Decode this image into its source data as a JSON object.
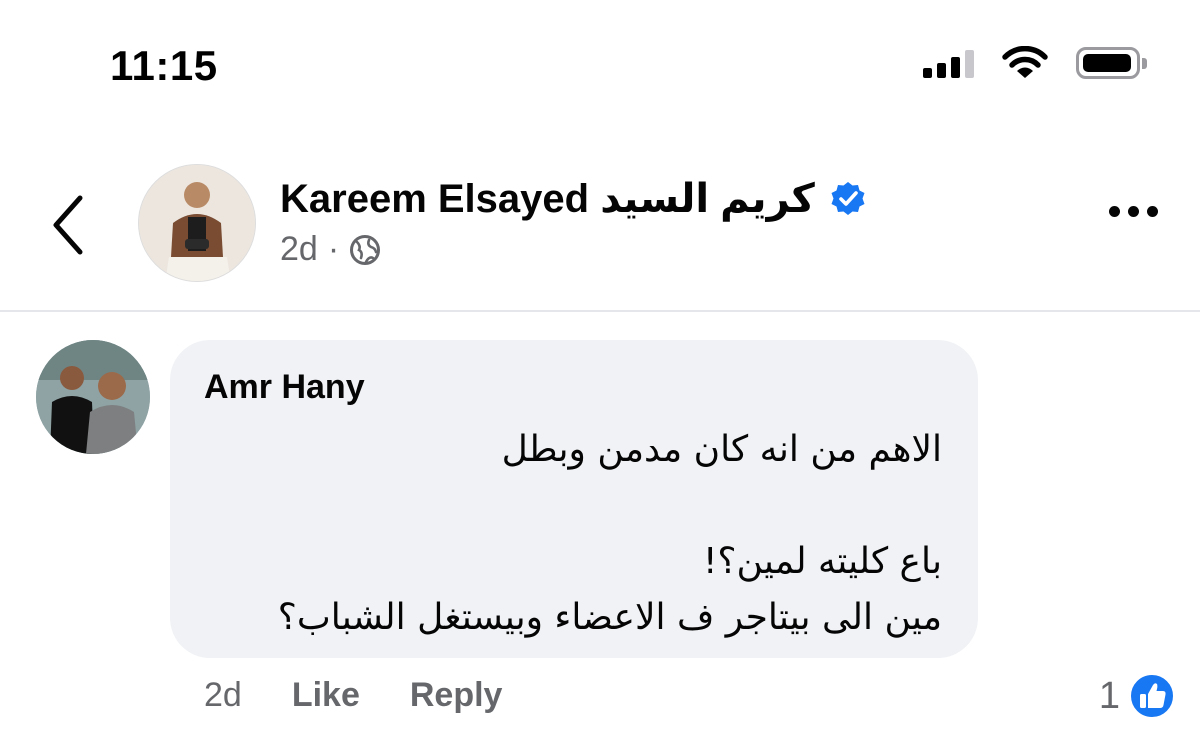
{
  "status_bar": {
    "time": "11:15",
    "icons": [
      "signal-icon",
      "wifi-icon",
      "battery-icon"
    ]
  },
  "post": {
    "author_name": "Kareem Elsayed كريم  السيد",
    "time": "2d",
    "separator": "·",
    "audience_icon": "globe-icon",
    "verified_icon": "verified-badge-icon"
  },
  "comment": {
    "author": "Amr Hany",
    "lines": [
      "الاهم من انه كان مدمن وبطل",
      "",
      "باع كليته لمين؟!",
      "مين الى بيتاجر ف الاعضاء وبيستغل الشباب؟"
    ],
    "time": "2d",
    "like_label": "Like",
    "reply_label": "Reply",
    "reaction_count": "1",
    "reaction_icon": "like-reaction-icon"
  },
  "colors": {
    "accent": "#1877f2",
    "bubble": "#f0f2f5",
    "secondary_text": "#65676b"
  }
}
